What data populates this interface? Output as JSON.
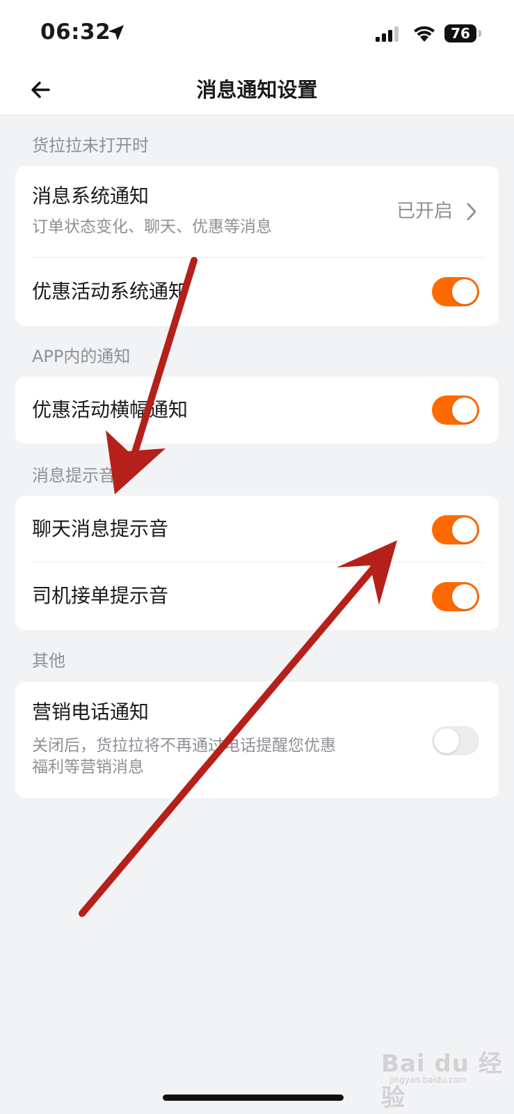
{
  "status_bar": {
    "time": "06:32",
    "battery": "76",
    "icons": [
      "location-arrow-icon",
      "signal-icon",
      "wifi-icon",
      "battery-icon"
    ]
  },
  "nav": {
    "title": "消息通知设置",
    "back_icon": "arrow-left-icon"
  },
  "sections": [
    {
      "label": "货拉拉未打开时",
      "rows": [
        {
          "title": "消息系统通知",
          "subtitle": "订单状态变化、聊天、优惠等消息",
          "value": "已开启",
          "control": "chevron"
        },
        {
          "title": "优惠活动系统通知",
          "control": "toggle",
          "on": true
        }
      ]
    },
    {
      "label": "APP内的通知",
      "rows": [
        {
          "title": "优惠活动横幅通知",
          "control": "toggle",
          "on": true
        }
      ]
    },
    {
      "label": "消息提示音",
      "rows": [
        {
          "title": "聊天消息提示音",
          "control": "toggle",
          "on": true
        },
        {
          "title": "司机接单提示音",
          "control": "toggle",
          "on": true
        }
      ]
    },
    {
      "label": "其他",
      "rows": [
        {
          "title": "营销电话通知",
          "subtitle_line1": "关闭后，货拉拉将不再通过电话提醒您优惠",
          "subtitle_line2": "福利等营销消息",
          "control": "toggle",
          "on": false
        }
      ]
    }
  ],
  "colors": {
    "accent": "#ff6a00",
    "toggle_off": "#ececed",
    "background": "#f2f3f5",
    "secondary_text": "#8d9096",
    "annotation_arrow": "#b5201a"
  },
  "watermark": {
    "text": "Bai du 经验",
    "sub": "jingyan.baidu.com"
  }
}
